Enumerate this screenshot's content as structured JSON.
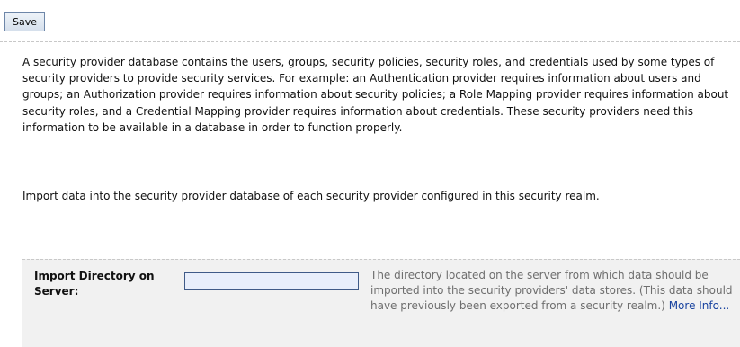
{
  "toolbar": {
    "save_label": "Save"
  },
  "description": "A security provider database contains the users, groups, security policies, security roles, and credentials used by some types of security providers to provide security services. For example: an Authentication provider requires information about users and groups; an Authorization provider requires information about security policies; a Role Mapping provider requires information about security roles, and a Credential Mapping provider requires information about credentials. These security providers need this information to be available in a database in order to function properly.",
  "instruction": "Import data into the security provider database of each security provider configured in this security realm.",
  "import_directory": {
    "label": "Import Directory on Server:",
    "value": "",
    "help_text": "The directory located on the server from which data should be imported into the security providers' data stores. (This data should have previously been exported from a security realm.)",
    "more_info_label": "More Info..."
  }
}
